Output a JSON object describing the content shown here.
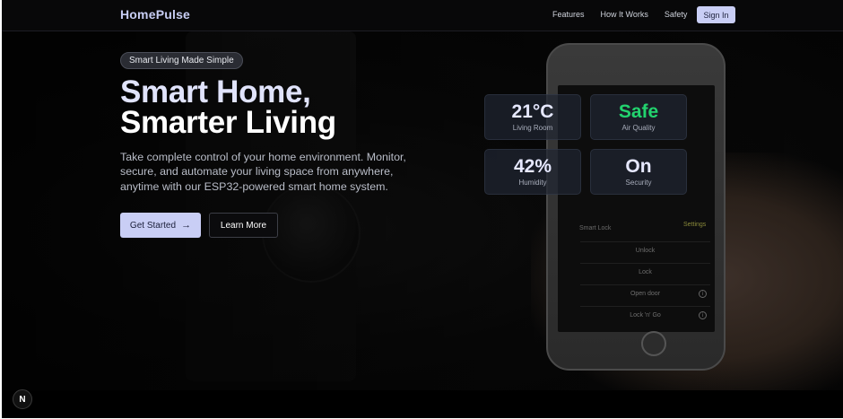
{
  "nav": {
    "brand": "HomePulse",
    "links": [
      "Features",
      "How It Works",
      "Safety"
    ],
    "signin": "Sign In"
  },
  "hero": {
    "badge": "Smart Living Made Simple",
    "headline_line1": "Smart Home,",
    "headline_line2": "Smarter Living",
    "subtext": "Take complete control of your home environment. Monitor, secure, and automate your living space from anywhere, anytime with our ESP32-powered smart home system.",
    "primary_button": "Get Started",
    "primary_icon": "arrow-right-icon",
    "secondary_button": "Learn More"
  },
  "stats": [
    {
      "value": "21°C",
      "label": "Living Room",
      "color": "#e6e8ff"
    },
    {
      "value": "Safe",
      "label": "Air Quality",
      "color": "#22d36e"
    },
    {
      "value": "42%",
      "label": "Humidity",
      "color": "#e6e8ff"
    },
    {
      "value": "On",
      "label": "Security",
      "color": "#e6e8ff"
    }
  ],
  "phone_screen": {
    "title": "Smart Lock",
    "settings": "Settings",
    "rows": [
      "Unlock",
      "Lock",
      "Open door",
      "Lock 'n' Go"
    ]
  },
  "corner_badge": "N",
  "colors": {
    "accent": "#c9cef5",
    "safe_green": "#22d36e",
    "background": "#000000"
  }
}
